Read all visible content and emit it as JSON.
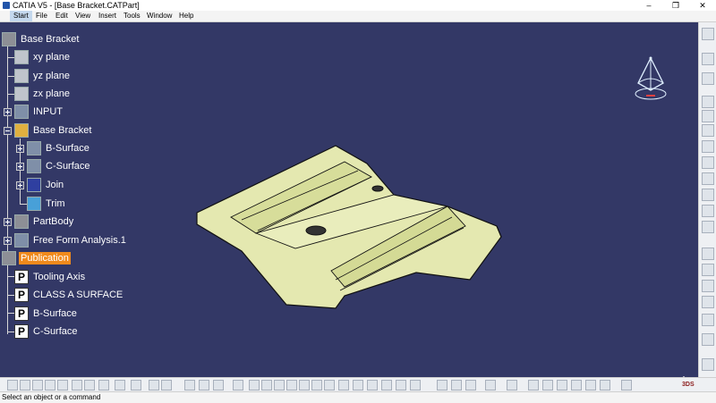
{
  "window": {
    "title": "CATIA V5 - [Base Bracket.CATPart]",
    "min": "–",
    "max": "❐",
    "close": "✕"
  },
  "menu": [
    "Start",
    "File",
    "Edit",
    "View",
    "Insert",
    "Tools",
    "Window",
    "Help"
  ],
  "tree": {
    "root": "Base Bracket",
    "planes": [
      "xy plane",
      "yz plane",
      "zx plane"
    ],
    "input": "INPUT",
    "set": "Base Bracket",
    "set_children": [
      "B-Surface",
      "C-Surface",
      "Join",
      "Trim"
    ],
    "partbody": "PartBody",
    "analysis": "Free Form Analysis.1",
    "publication": "Publication",
    "pub_children": [
      "Tooling Axis",
      "CLASS A SURFACE",
      "B-Surface",
      "C-Surface"
    ]
  },
  "status": {
    "prompt": "Select an object or a command"
  },
  "colors": {
    "background": "#333866",
    "part": "#e4e8b0",
    "selection": "#f08a1c"
  }
}
